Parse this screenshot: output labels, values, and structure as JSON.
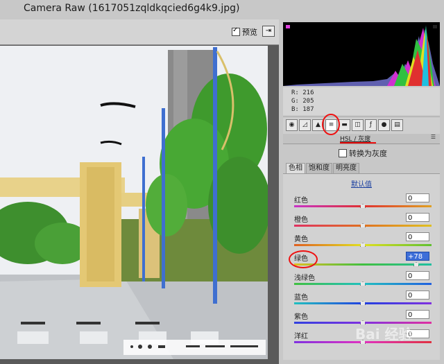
{
  "window": {
    "title": "Camera Raw (1617051zqldkqcied6g4k9.jpg)"
  },
  "toolbar": {
    "preview_label": "预览",
    "preview_checked": true
  },
  "readout": {
    "r": "R:  216",
    "g": "G:  205",
    "b": "B:  187"
  },
  "panel": {
    "title": "HSL / 灰度",
    "convert_gray_label": "转换为灰度",
    "subtabs": [
      "色相",
      "饱和度",
      "明亮度"
    ],
    "active_subtab": "色相",
    "defaults_link": "默认值",
    "sliders": [
      {
        "label": "红色",
        "value": "0",
        "pos": 0.5
      },
      {
        "label": "橙色",
        "value": "0",
        "pos": 0.5
      },
      {
        "label": "黄色",
        "value": "0",
        "pos": 0.5
      },
      {
        "label": "绿色",
        "value": "+78",
        "pos": 0.89,
        "focused": true
      },
      {
        "label": "浅绿色",
        "value": "0",
        "pos": 0.5
      },
      {
        "label": "蓝色",
        "value": "0",
        "pos": 0.5
      },
      {
        "label": "紫色",
        "value": "0",
        "pos": 0.5
      },
      {
        "label": "洋红",
        "value": "0",
        "pos": 0.5
      }
    ]
  },
  "watermark": "Bai 经验",
  "colors": {
    "accent": "#3d6ed8",
    "annotation": "#ee1111"
  }
}
